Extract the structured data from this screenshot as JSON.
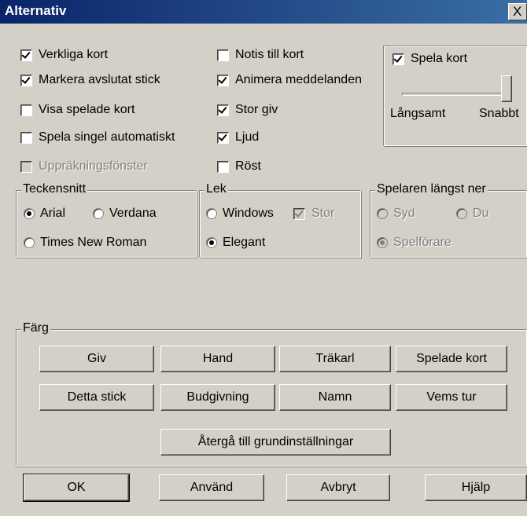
{
  "window": {
    "title": "Alternativ",
    "close_glyph": "X"
  },
  "options_left": [
    {
      "label": "Verkliga kort",
      "checked": true
    },
    {
      "label": "Markera avslutat stick",
      "checked": true
    },
    {
      "label": "Visa spelade kort",
      "checked": false
    },
    {
      "label": "Spela singel automatiskt",
      "checked": false
    },
    {
      "label": "Uppräkningsfönster",
      "checked": false,
      "disabled": true
    }
  ],
  "options_mid": [
    {
      "label": "Notis till kort",
      "checked": false
    },
    {
      "label": "Animera meddelanden",
      "checked": true
    },
    {
      "label": "Stor giv",
      "checked": true
    },
    {
      "label": "Ljud",
      "checked": true
    },
    {
      "label": "Röst",
      "checked": false
    }
  ],
  "speed": {
    "checkbox_label": "Spela kort",
    "checked": true,
    "min_label": "Långsamt",
    "max_label": "Snabbt",
    "value": 1.0
  },
  "font_group": {
    "title": "Teckensnitt",
    "options": [
      "Arial",
      "Verdana",
      "Times New Roman"
    ],
    "selected": "Arial"
  },
  "deck_group": {
    "title": "Lek",
    "options": [
      "Windows",
      "Elegant"
    ],
    "selected": "Elegant",
    "large_label": "Stor",
    "large_checked": true
  },
  "bottom_player_group": {
    "title": "Spelaren längst ner",
    "options": [
      "Syd",
      "Du",
      "Spelförare"
    ],
    "selected": "Spelförare"
  },
  "color_group": {
    "title": "Färg",
    "buttons": [
      "Giv",
      "Hand",
      "Träkarl",
      "Spelade kort",
      "Detta stick",
      "Budgivning",
      "Namn",
      "Vems tur"
    ],
    "reset_label": "Återgå till grundinställningar"
  },
  "footer": {
    "ok": "OK",
    "apply": "Använd",
    "cancel": "Avbryt",
    "help": "Hjälp"
  }
}
